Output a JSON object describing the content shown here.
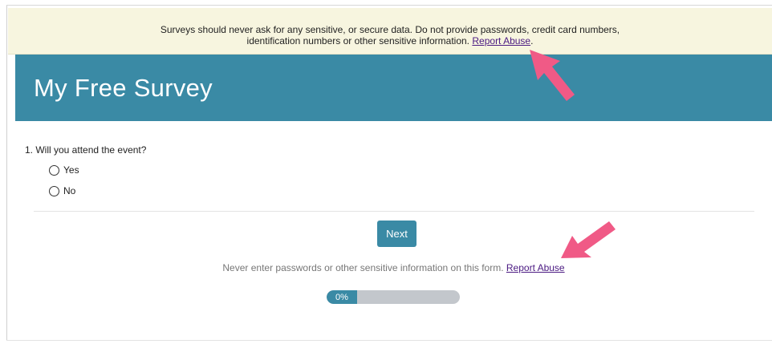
{
  "warning_banner": {
    "line1": "Surveys should never ask for any sensitive, or secure data. Do not provide passwords, credit card numbers,",
    "line2": "identification numbers or other sensitive information.",
    "link": "Report Abuse",
    "suffix": "."
  },
  "survey": {
    "title": "My Free Survey",
    "question": "1. Will you attend the event?",
    "options": [
      "Yes",
      "No"
    ],
    "next_label": "Next"
  },
  "footer": {
    "note": "Never enter passwords or other sensitive information on this form.",
    "link": "Report Abuse"
  },
  "progress": {
    "label": "0%",
    "value": 0
  },
  "colors": {
    "accent": "#3a8aa5",
    "banner_bg": "#f7f5df",
    "arrow": "#f05a86",
    "link": "#4b1a82"
  }
}
